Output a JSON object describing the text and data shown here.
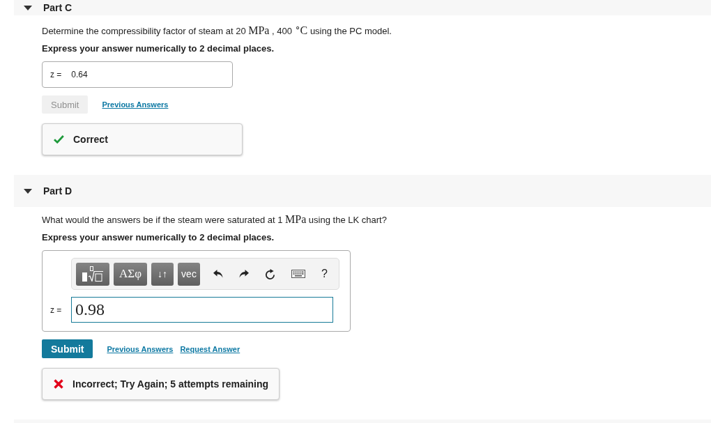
{
  "parts": [
    {
      "label": "Part C",
      "expanded": true,
      "prompt": [
        {
          "kind": "text",
          "text": "Determine the compressibility factor of steam at 20 "
        },
        {
          "kind": "math",
          "text": "MPa"
        },
        {
          "kind": "text",
          "text": " , 400 "
        },
        {
          "kind": "math",
          "text": "$^{∘}$C"
        },
        {
          "kind": "text",
          "text": " using the PC model."
        }
      ],
      "instruction": "Express your answer numerically to 2 decimal places.",
      "answer": {
        "kind": "plain",
        "label": "z =",
        "value": "0.64"
      },
      "submit": {
        "label": "Submit",
        "disabled": true
      },
      "links": [
        {
          "label": "Previous Answers"
        }
      ],
      "feedback": {
        "kind": "correct",
        "text": "Correct"
      }
    },
    {
      "label": "Part D",
      "expanded": true,
      "prompt": [
        {
          "kind": "text",
          "text": "What would the answers be if the steam were saturated at 1 "
        },
        {
          "kind": "math",
          "text": "MPa"
        },
        {
          "kind": "text",
          "text": " using the LK chart?"
        }
      ],
      "instruction": "Express your answer numerically to 2 decimal places.",
      "answer": {
        "kind": "editor",
        "label": "z =",
        "value": "0.98",
        "palettes": [
          {
            "kind": "templates"
          },
          {
            "kind": "symbols",
            "label": "ΑΣφ"
          },
          {
            "kind": "arrows",
            "label": "↓↑"
          },
          {
            "kind": "vector",
            "label": "vec"
          }
        ],
        "tools": [
          {
            "kind": "undo"
          },
          {
            "kind": "redo"
          },
          {
            "kind": "reset"
          },
          {
            "kind": "keyboard"
          },
          {
            "kind": "help",
            "label": "?"
          }
        ]
      },
      "submit": {
        "label": "Submit",
        "disabled": false
      },
      "links": [
        {
          "label": "Previous Answers"
        },
        {
          "label": "Request Answer"
        }
      ],
      "feedback": {
        "kind": "incorrect",
        "text": "Incorrect; Try Again; 5 attempts remaining"
      }
    }
  ]
}
